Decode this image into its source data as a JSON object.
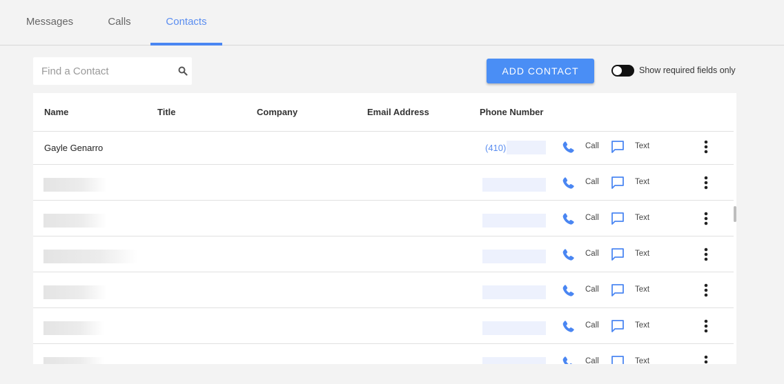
{
  "tabs": [
    {
      "label": "Messages"
    },
    {
      "label": "Calls"
    },
    {
      "label": "Contacts",
      "active": true
    }
  ],
  "search": {
    "placeholder": "Find a Contact",
    "value": ""
  },
  "toolbar": {
    "add_contact_label": "ADD CONTACT",
    "toggle_label": "Show required fields only",
    "toggle_on": true
  },
  "table": {
    "columns": [
      "Name",
      "Title",
      "Company",
      "Email Address",
      "Phone Number"
    ],
    "rows": [
      {
        "name": "Gayle Genarro",
        "phone_area": "(410)",
        "call_label": "Call",
        "text_label": "Text"
      },
      {
        "name": "",
        "call_label": "Call",
        "text_label": "Text"
      },
      {
        "name": "",
        "call_label": "Call",
        "text_label": "Text"
      },
      {
        "name": "",
        "call_label": "Call",
        "text_label": "Text"
      },
      {
        "name": "",
        "call_label": "Call",
        "text_label": "Text"
      },
      {
        "name": "",
        "call_label": "Call",
        "text_label": "Text"
      },
      {
        "name": "",
        "call_label": "Call",
        "text_label": "Text"
      }
    ]
  },
  "colors": {
    "accent": "#4a8ef5",
    "tab_active": "#5a8df0",
    "background": "#f3f3f3"
  }
}
